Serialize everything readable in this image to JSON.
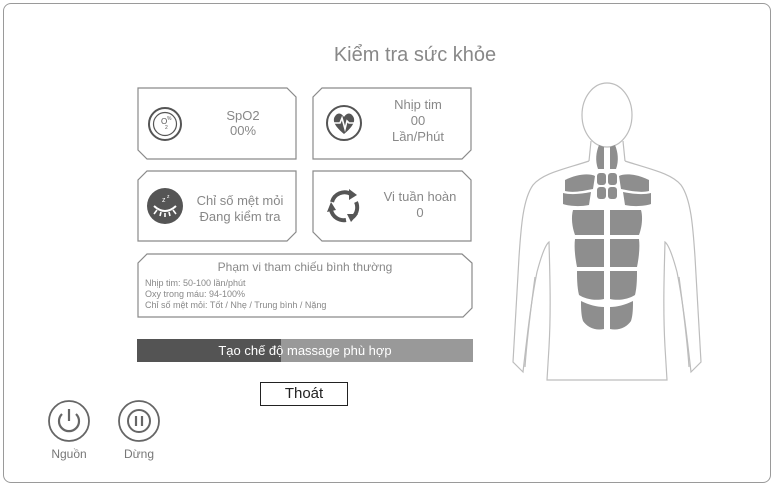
{
  "title": "Kiểm tra sức khỏe",
  "cards": {
    "spo2": {
      "label": "SpO2",
      "value": "00%"
    },
    "heart": {
      "label": "Nhịp tim",
      "value": "00",
      "unit": "Lần/Phút"
    },
    "fatigue": {
      "label": "Chỉ số mệt mỏi",
      "value": "Đang kiểm tra"
    },
    "circulation": {
      "label": "Vi tuần hoàn",
      "value": "0"
    }
  },
  "reference": {
    "heading": "Phạm vi tham chiếu bình thường",
    "lines": [
      "Nhịp tim:  50-100 lần/phút",
      "Oxy trong máu:  94-100%",
      "Chỉ số mệt mỏi: Tốt / Nhẹ / Trung bình / Nặng"
    ]
  },
  "progress": {
    "label": "Tạo chế độ massage phù hợp",
    "fraction": 0.43
  },
  "exit_label": "Thoát",
  "buttons": {
    "power_label": "Nguồn",
    "pause_label": "Dừng"
  },
  "icons": [
    "oxygen-icon",
    "heart-rate-icon",
    "sleepy-eye-icon",
    "circulation-icon",
    "power-icon",
    "pause-icon"
  ]
}
